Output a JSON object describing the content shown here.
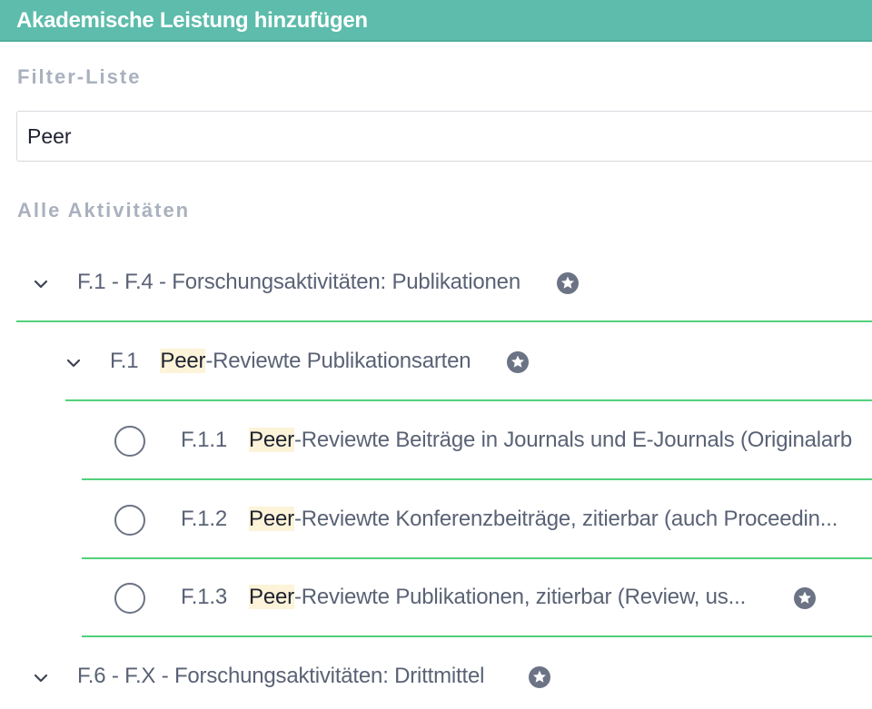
{
  "header": {
    "title": "Akademische Leistung hinzufügen"
  },
  "filter": {
    "label": "Filter-Liste",
    "value": "Peer"
  },
  "activities": {
    "label": "Alle Aktivitäten"
  },
  "tree": {
    "g1": {
      "title": "F.1 - F.4 - Forschungsaktivitäten: Publikationen"
    },
    "g1_sub": {
      "code": "F.1",
      "highlight": "Peer",
      "rest": "-Reviewte Publikationsarten"
    },
    "items": [
      {
        "code": "F.1.1",
        "highlight": "Peer",
        "rest": "-Reviewte Beiträge in Journals und E-Journals (Originalarb"
      },
      {
        "code": "F.1.2",
        "highlight": "Peer",
        "rest": "-Reviewte Konferenzbeiträge, zitierbar (auch Proceedin..."
      },
      {
        "code": "F.1.3",
        "highlight": "Peer",
        "rest": "-Reviewte Publikationen, zitierbar (Review, us..."
      }
    ],
    "g2": {
      "title": "F.6 - F.X - Forschungsaktivitäten: Drittmittel"
    }
  },
  "colors": {
    "header": "#5dbcab",
    "divider": "#52d17b",
    "highlight": "#fcf3d9",
    "label": "#a9b1be"
  },
  "icons": {
    "expand": "chevron-down-icon",
    "favorite": "star-circle-icon",
    "select": "radio-circle-icon"
  }
}
